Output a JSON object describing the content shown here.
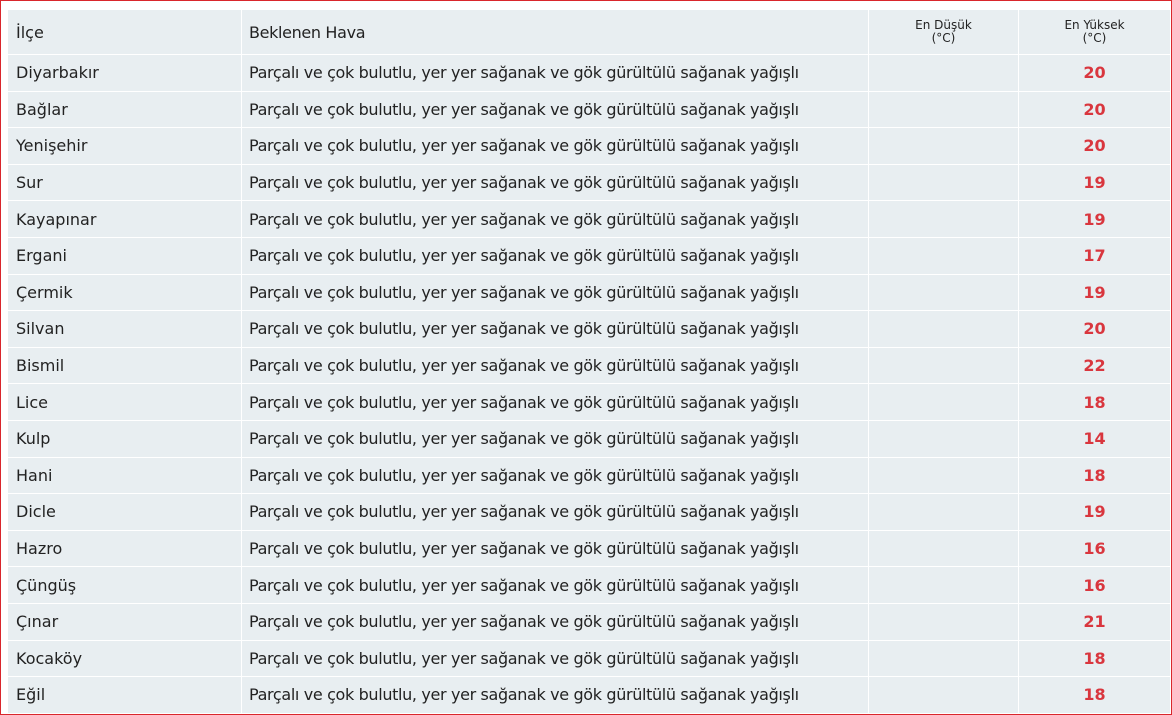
{
  "colors": {
    "frame_border": "#d9262c",
    "cell_background": "#e8eef1",
    "max_temp_text": "#d9363e"
  },
  "table": {
    "headers": {
      "district": "İlçe",
      "expected_weather": "Beklenen Hava",
      "min_temp_title": "En Düşük",
      "min_temp_unit": "(°C)",
      "max_temp_title": "En Yüksek",
      "max_temp_unit": "(°C)"
    },
    "rows": [
      {
        "district": "Diyarbakır",
        "weather": "Parçalı ve çok bulutlu, yer yer sağanak ve gök gürültülü sağanak yağışlı",
        "min": "",
        "max": "20"
      },
      {
        "district": "Bağlar",
        "weather": "Parçalı ve çok bulutlu, yer yer sağanak ve gök gürültülü sağanak yağışlı",
        "min": "",
        "max": "20"
      },
      {
        "district": "Yenişehir",
        "weather": "Parçalı ve çok bulutlu, yer yer sağanak ve gök gürültülü sağanak yağışlı",
        "min": "",
        "max": "20"
      },
      {
        "district": "Sur",
        "weather": "Parçalı ve çok bulutlu, yer yer sağanak ve gök gürültülü sağanak yağışlı",
        "min": "",
        "max": "19"
      },
      {
        "district": "Kayapınar",
        "weather": "Parçalı ve çok bulutlu, yer yer sağanak ve gök gürültülü sağanak yağışlı",
        "min": "",
        "max": "19"
      },
      {
        "district": "Ergani",
        "weather": "Parçalı ve çok bulutlu, yer yer sağanak ve gök gürültülü sağanak yağışlı",
        "min": "",
        "max": "17"
      },
      {
        "district": "Çermik",
        "weather": "Parçalı ve çok bulutlu, yer yer sağanak ve gök gürültülü sağanak yağışlı",
        "min": "",
        "max": "19"
      },
      {
        "district": "Silvan",
        "weather": "Parçalı ve çok bulutlu, yer yer sağanak ve gök gürültülü sağanak yağışlı",
        "min": "",
        "max": "20"
      },
      {
        "district": "Bismil",
        "weather": "Parçalı ve çok bulutlu, yer yer sağanak ve gök gürültülü sağanak yağışlı",
        "min": "",
        "max": "22"
      },
      {
        "district": "Lice",
        "weather": "Parçalı ve çok bulutlu, yer yer sağanak ve gök gürültülü sağanak yağışlı",
        "min": "",
        "max": "18"
      },
      {
        "district": "Kulp",
        "weather": "Parçalı ve çok bulutlu, yer yer sağanak ve gök gürültülü sağanak yağışlı",
        "min": "",
        "max": "14"
      },
      {
        "district": "Hani",
        "weather": "Parçalı ve çok bulutlu, yer yer sağanak ve gök gürültülü sağanak yağışlı",
        "min": "",
        "max": "18"
      },
      {
        "district": "Dicle",
        "weather": "Parçalı ve çok bulutlu, yer yer sağanak ve gök gürültülü sağanak yağışlı",
        "min": "",
        "max": "19"
      },
      {
        "district": "Hazro",
        "weather": "Parçalı ve çok bulutlu, yer yer sağanak ve gök gürültülü sağanak yağışlı",
        "min": "",
        "max": "16"
      },
      {
        "district": "Çüngüş",
        "weather": "Parçalı ve çok bulutlu, yer yer sağanak ve gök gürültülü sağanak yağışlı",
        "min": "",
        "max": "16"
      },
      {
        "district": "Çınar",
        "weather": "Parçalı ve çok bulutlu, yer yer sağanak ve gök gürültülü sağanak yağışlı",
        "min": "",
        "max": "21"
      },
      {
        "district": "Kocaköy",
        "weather": "Parçalı ve çok bulutlu, yer yer sağanak ve gök gürültülü sağanak yağışlı",
        "min": "",
        "max": "18"
      },
      {
        "district": "Eğil",
        "weather": "Parçalı ve çok bulutlu, yer yer sağanak ve gök gürültülü sağanak yağışlı",
        "min": "",
        "max": "18"
      }
    ]
  }
}
